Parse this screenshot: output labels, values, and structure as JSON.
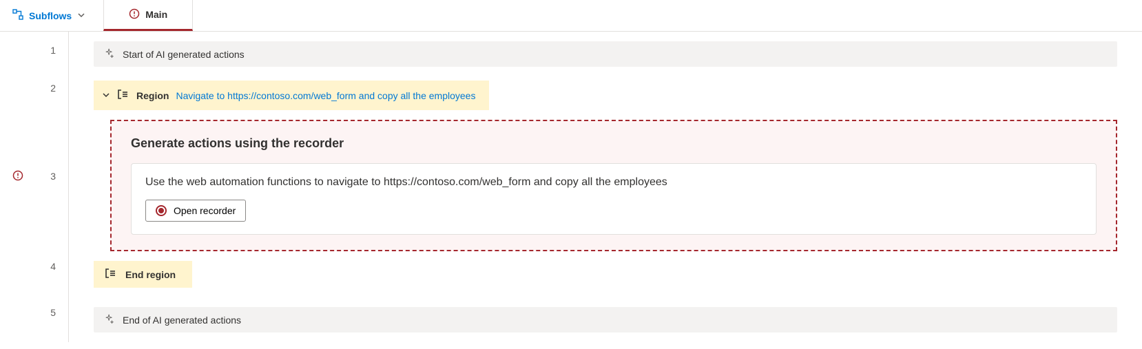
{
  "toolbar": {
    "subflows_label": "Subflows",
    "tab_label": "Main"
  },
  "lines": {
    "l1": "1",
    "l2": "2",
    "l3": "3",
    "l4": "4",
    "l5": "5"
  },
  "actions": {
    "start_label": "Start of AI generated actions",
    "region_label": "Region",
    "region_link": "Navigate to https://contoso.com/web_form and copy all the employees",
    "end_region_label": "End region",
    "end_label": "End of AI generated actions"
  },
  "recorder": {
    "title": "Generate actions using the recorder",
    "description": "Use the web automation functions to navigate to https://contoso.com/web_form and copy all the employees",
    "button_label": "Open recorder"
  }
}
